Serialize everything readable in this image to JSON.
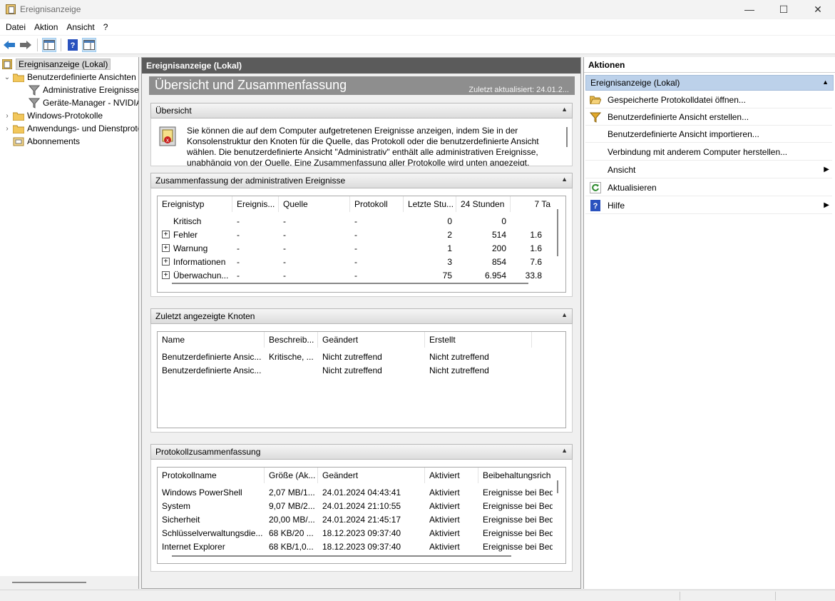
{
  "window": {
    "title": "Ereignisanzeige",
    "min": "—",
    "max": "☐",
    "close": "✕"
  },
  "menu": [
    "Datei",
    "Aktion",
    "Ansicht",
    "?"
  ],
  "tree": {
    "root": "Ereignisanzeige (Lokal)",
    "custom_views": "Benutzerdefinierte Ansichten",
    "admin_events": "Administrative Ereignisse",
    "device_manager": "Geräte-Manager - NVIDIA",
    "windows_logs": "Windows-Protokolle",
    "app_logs": "Anwendungs- und Dienstprotokolle",
    "subscriptions": "Abonnements"
  },
  "center": {
    "header": "Ereignisanzeige (Lokal)",
    "banner_title": "Übersicht und Zusammenfassung",
    "banner_sub": "Zuletzt aktualisiert: 24.01.2...",
    "overview": {
      "title": "Übersicht",
      "text": "Sie können die auf dem Computer aufgetretenen Ereignisse anzeigen, indem Sie in der Konsolenstruktur den Knoten für die Quelle, das Protokoll oder die benutzerdefinierte Ansicht wählen. Die benutzerdefinierte Ansicht \"Administrativ\" enthält alle administrativen Ereignisse, unabhängig von der Quelle. Eine Zusammenfassung aller Protokolle wird unten angezeigt."
    },
    "admin_summary": {
      "title": "Zusammenfassung der administrativen Ereignisse",
      "columns": [
        "Ereignistyp",
        "Ereignis...",
        "Quelle",
        "Protokoll",
        "Letzte Stu...",
        "24 Stunden",
        "7 Ta"
      ],
      "rows": [
        {
          "type": "Kritisch",
          "expand": "",
          "id": "-",
          "source": "-",
          "log": "-",
          "hour": "0",
          "day": "0",
          "week": ""
        },
        {
          "type": "Fehler",
          "expand": "+",
          "id": "-",
          "source": "-",
          "log": "-",
          "hour": "2",
          "day": "514",
          "week": "1.6"
        },
        {
          "type": "Warnung",
          "expand": "+",
          "id": "-",
          "source": "-",
          "log": "-",
          "hour": "1",
          "day": "200",
          "week": "1.6"
        },
        {
          "type": "Informationen",
          "expand": "+",
          "id": "-",
          "source": "-",
          "log": "-",
          "hour": "3",
          "day": "854",
          "week": "7.6"
        },
        {
          "type": "Überwachun...",
          "expand": "+",
          "id": "-",
          "source": "-",
          "log": "-",
          "hour": "75",
          "day": "6.954",
          "week": "33.8"
        }
      ]
    },
    "recent_nodes": {
      "title": "Zuletzt angezeigte Knoten",
      "columns": [
        "Name",
        "Beschreib...",
        "Geändert",
        "Erstellt"
      ],
      "rows": [
        {
          "name": "Benutzerdefinierte Ansic...",
          "desc": "Kritische, ...",
          "changed": "Nicht zutreffend",
          "created": "Nicht zutreffend"
        },
        {
          "name": "Benutzerdefinierte Ansic...",
          "desc": "",
          "changed": "Nicht zutreffend",
          "created": "Nicht zutreffend"
        }
      ]
    },
    "log_summary": {
      "title": "Protokollzusammenfassung",
      "columns": [
        "Protokollname",
        "Größe (Ak...",
        "Geändert",
        "Aktiviert",
        "Beibehaltungsrich"
      ],
      "rows": [
        {
          "name": "Windows PowerShell",
          "size": "2,07 MB/1...",
          "changed": "24.01.2024 04:43:41",
          "enabled": "Aktiviert",
          "retention": "Ereignisse bei Beda"
        },
        {
          "name": "System",
          "size": "9,07 MB/2...",
          "changed": "24.01.2024 21:10:55",
          "enabled": "Aktiviert",
          "retention": "Ereignisse bei Beda"
        },
        {
          "name": "Sicherheit",
          "size": "20,00 MB/...",
          "changed": "24.01.2024 21:45:17",
          "enabled": "Aktiviert",
          "retention": "Ereignisse bei Beda"
        },
        {
          "name": "Schlüsselverwaltungsdie...",
          "size": "68 KB/20 ...",
          "changed": "18.12.2023 09:37:40",
          "enabled": "Aktiviert",
          "retention": "Ereignisse bei Beda"
        },
        {
          "name": "Internet Explorer",
          "size": "68 KB/1,0...",
          "changed": "18.12.2023 09:37:40",
          "enabled": "Aktiviert",
          "retention": "Ereignisse bei Beda"
        }
      ]
    }
  },
  "actions": {
    "title": "Aktionen",
    "group": "Ereignisanzeige (Lokal)",
    "items": [
      "Gespeicherte Protokolldatei öffnen...",
      "Benutzerdefinierte Ansicht erstellen...",
      "Benutzerdefinierte Ansicht importieren...",
      "Verbindung mit anderem Computer herstellen...",
      "Ansicht",
      "Aktualisieren",
      "Hilfe"
    ]
  }
}
